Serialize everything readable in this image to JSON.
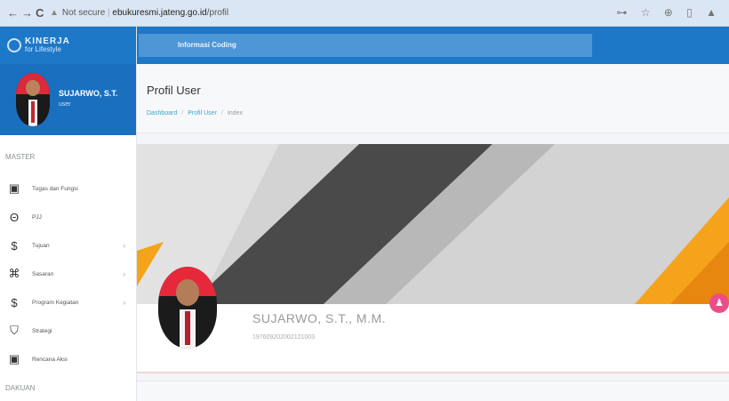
{
  "browser": {
    "back": "←",
    "forward": "→",
    "reload": "C",
    "security_label": "Not secure",
    "url_domain": "ebukuresmi.jateng.go.id",
    "url_path": "/profil",
    "extension_icons": "⊶ ☆ ⊕ ▯ ▲"
  },
  "brand": {
    "name": "KINERJA",
    "tagline": "for Lifestyle"
  },
  "user": {
    "name": "SUJARWO, S.T.",
    "role": "user"
  },
  "sidebar": {
    "section_master": "MASTER",
    "section_bottom": "DAKUAN",
    "items": [
      {
        "label": "Tugas dan Fungsi",
        "icon": "document-icon",
        "glyph": "▣",
        "chevron": ""
      },
      {
        "label": "PJJ",
        "icon": "user-circle-icon",
        "glyph": "Θ",
        "chevron": ""
      },
      {
        "label": "Tujuan",
        "icon": "dollar-icon",
        "glyph": "$",
        "chevron": "›"
      },
      {
        "label": "Sasaran",
        "icon": "network-icon",
        "glyph": "⌘",
        "chevron": "›"
      },
      {
        "label": "Program Kegiatan",
        "icon": "money-icon",
        "glyph": "$",
        "chevron": "›"
      },
      {
        "label": "Strategi",
        "icon": "shield-icon",
        "glyph": "⛉",
        "chevron": ""
      },
      {
        "label": "Rencana Aksi",
        "icon": "clipboard-icon",
        "glyph": "▣",
        "chevron": ""
      }
    ]
  },
  "topbar": {
    "info_label": "Informasi Coding"
  },
  "page": {
    "title": "Profil User",
    "breadcrumb": [
      "Dashboard",
      "Profil User",
      "Index"
    ]
  },
  "profile": {
    "name": "SUJARWO, S.T., M.M.",
    "id_number": "197609202002121003"
  },
  "colors": {
    "header_blue": "#1e78c8",
    "accent_orange": "#f5a31a",
    "fab_pink": "#ec4d8a"
  }
}
